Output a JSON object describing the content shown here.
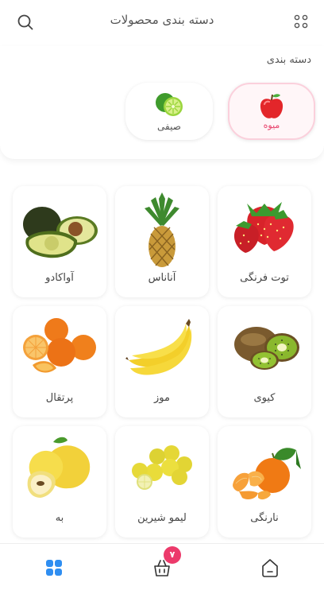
{
  "header": {
    "title": "دسته بندی محصولات",
    "search_icon": "search-icon",
    "menu_icon": "grid-dots-icon"
  },
  "categories": {
    "title": "دسته بندی",
    "items": [
      {
        "label": "میوه",
        "icon": "apple-icon",
        "active": true
      },
      {
        "label": "صیفی",
        "icon": "lime-icon",
        "active": false
      }
    ]
  },
  "products": [
    {
      "name": "توت فرنگی",
      "image": "strawberry"
    },
    {
      "name": "آناناس",
      "image": "pineapple"
    },
    {
      "name": "آواکادو",
      "image": "avocado"
    },
    {
      "name": "کیوی",
      "image": "kiwi"
    },
    {
      "name": "موز",
      "image": "banana"
    },
    {
      "name": "پرتقال",
      "image": "orange"
    },
    {
      "name": "نارنگی",
      "image": "tangerine"
    },
    {
      "name": "لیمو شیرین",
      "image": "sweet-lemon"
    },
    {
      "name": "به",
      "image": "quince"
    }
  ],
  "bottom_nav": {
    "home_icon": "home-icon",
    "cart_icon": "basket-icon",
    "cart_count": "۷",
    "categories_icon": "grid-icon"
  },
  "colors": {
    "accent": "#ec3a6b",
    "nav_active": "#2f8ef1",
    "active_category_border": "#fbd0dc"
  }
}
